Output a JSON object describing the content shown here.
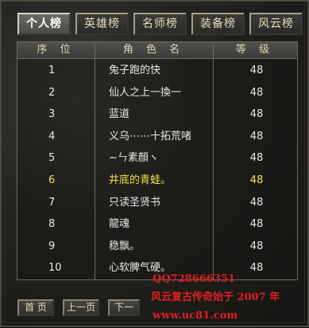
{
  "tabs": [
    {
      "label": "个人榜",
      "active": true
    },
    {
      "label": "英雄榜",
      "active": false
    },
    {
      "label": "名师榜",
      "active": false
    },
    {
      "label": "装备榜",
      "active": false
    },
    {
      "label": "风云榜",
      "active": false
    }
  ],
  "table": {
    "headers": {
      "rank": "序 位",
      "name": "角 色 名",
      "level": "等 级"
    },
    "rows": [
      {
        "rank": "1",
        "name": "兔子跑的快",
        "level": "48"
      },
      {
        "rank": "2",
        "name": "仙人之上一換一",
        "level": "48"
      },
      {
        "rank": "3",
        "name": "蓝道",
        "level": "48"
      },
      {
        "rank": "4",
        "name": "义乌⋯⋯十拓荒啫",
        "level": "48"
      },
      {
        "rank": "5",
        "name": "~ㄣ素顏ヽ",
        "level": "48"
      },
      {
        "rank": "6",
        "name": "井底的青蛙。",
        "level": "48",
        "highlight": true
      },
      {
        "rank": "7",
        "name": "只读圣贤书",
        "level": "48"
      },
      {
        "rank": "8",
        "name": "龍魂",
        "level": "48"
      },
      {
        "rank": "9",
        "name": "稳飘。",
        "level": "48"
      },
      {
        "rank": "10",
        "name": "心软脾气硬。",
        "level": "48"
      }
    ]
  },
  "pager": {
    "first": "首 页",
    "prev": "上一页",
    "next": "下一"
  },
  "watermark": {
    "qq": "QQ728666351",
    "slogan": "风云复古传奇始于 2007 年",
    "url": "www.uc81.com"
  },
  "colors": {
    "highlight": "#f2e34a",
    "watermark": "#e02020",
    "text": "#e8e8e8"
  }
}
